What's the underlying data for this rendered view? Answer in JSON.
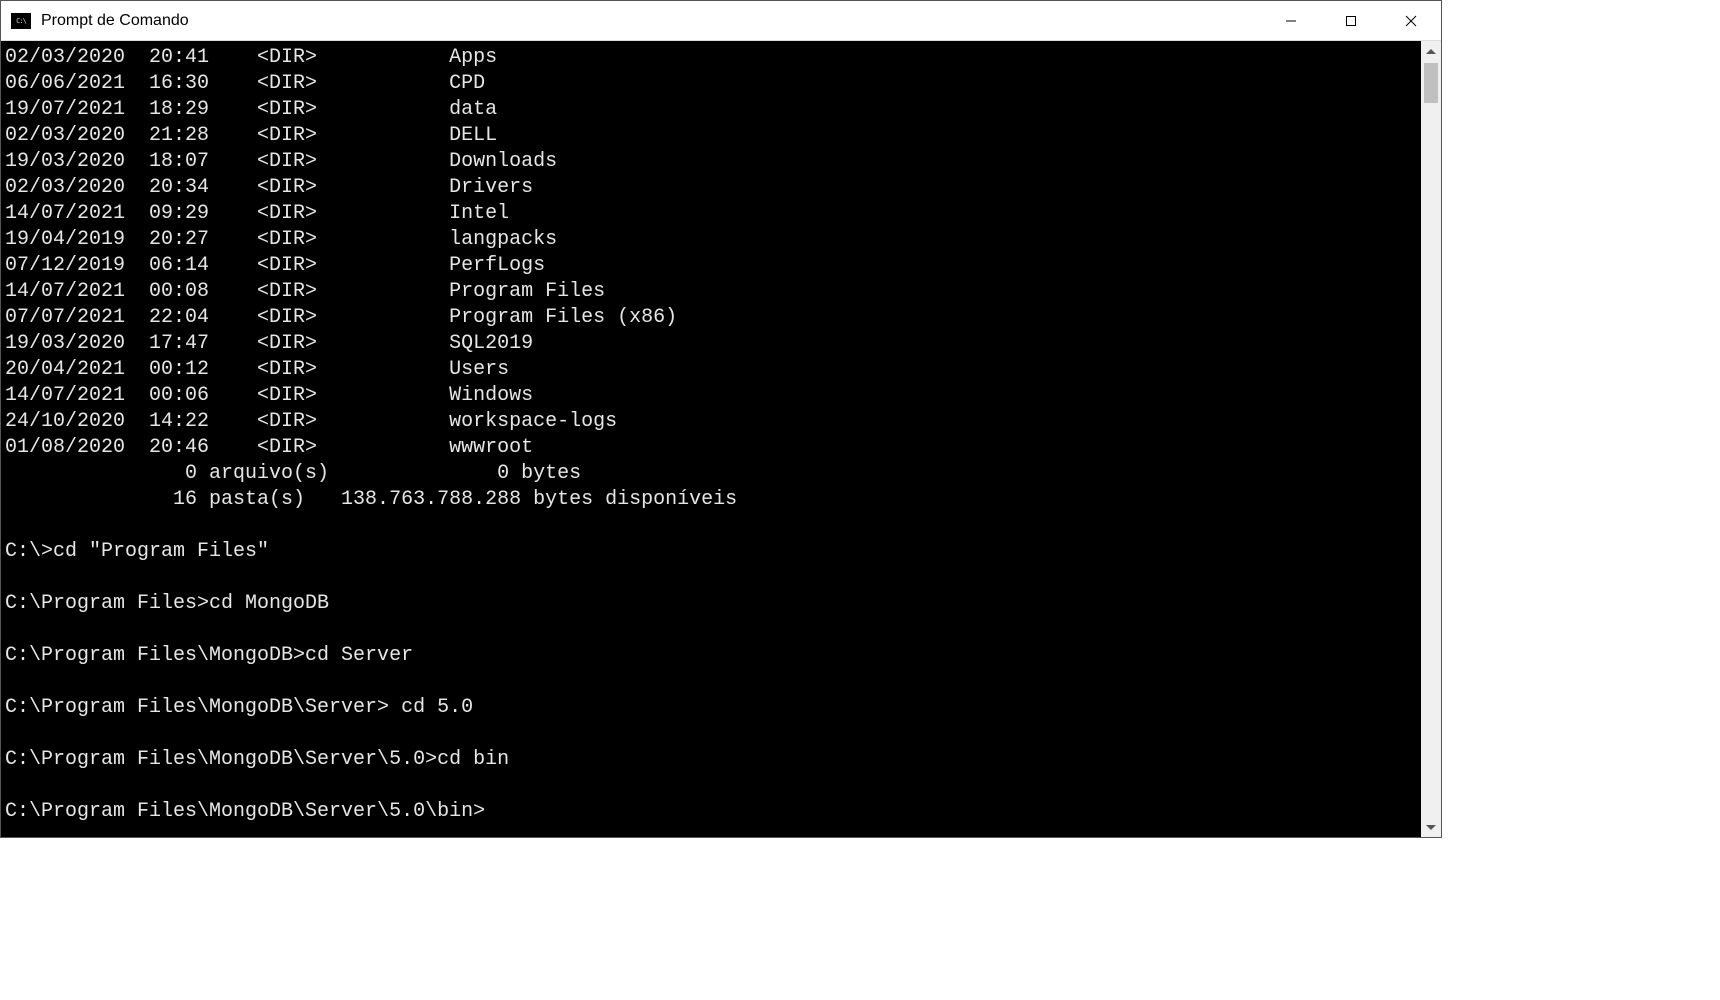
{
  "window": {
    "title": "Prompt de Comando"
  },
  "dir_entries": [
    {
      "date": "02/03/2020",
      "time": "20:41",
      "tag": "<DIR>",
      "size": "",
      "name": "Apps"
    },
    {
      "date": "06/06/2021",
      "time": "16:30",
      "tag": "<DIR>",
      "size": "",
      "name": "CPD"
    },
    {
      "date": "19/07/2021",
      "time": "18:29",
      "tag": "<DIR>",
      "size": "",
      "name": "data"
    },
    {
      "date": "02/03/2020",
      "time": "21:28",
      "tag": "<DIR>",
      "size": "",
      "name": "DELL"
    },
    {
      "date": "19/03/2020",
      "time": "18:07",
      "tag": "<DIR>",
      "size": "",
      "name": "Downloads"
    },
    {
      "date": "02/03/2020",
      "time": "20:34",
      "tag": "<DIR>",
      "size": "",
      "name": "Drivers"
    },
    {
      "date": "14/07/2021",
      "time": "09:29",
      "tag": "<DIR>",
      "size": "",
      "name": "Intel"
    },
    {
      "date": "19/04/2019",
      "time": "20:27",
      "tag": "<DIR>",
      "size": "",
      "name": "langpacks"
    },
    {
      "date": "07/12/2019",
      "time": "06:14",
      "tag": "<DIR>",
      "size": "",
      "name": "PerfLogs"
    },
    {
      "date": "14/07/2021",
      "time": "00:08",
      "tag": "<DIR>",
      "size": "",
      "name": "Program Files"
    },
    {
      "date": "07/07/2021",
      "time": "22:04",
      "tag": "<DIR>",
      "size": "",
      "name": "Program Files (x86)"
    },
    {
      "date": "19/03/2020",
      "time": "17:47",
      "tag": "<DIR>",
      "size": "",
      "name": "SQL2019"
    },
    {
      "date": "20/04/2021",
      "time": "00:12",
      "tag": "<DIR>",
      "size": "",
      "name": "Users"
    },
    {
      "date": "14/07/2021",
      "time": "00:06",
      "tag": "<DIR>",
      "size": "",
      "name": "Windows"
    },
    {
      "date": "24/10/2020",
      "time": "14:22",
      "tag": "<DIR>",
      "size": "",
      "name": "workspace-logs"
    },
    {
      "date": "01/08/2020",
      "time": "20:46",
      "tag": "<DIR>",
      "size": "",
      "name": "wwwroot"
    }
  ],
  "summary": {
    "files_line": "               0 arquivo(s)              0 bytes",
    "dirs_line": "              16 pasta(s)   138.763.788.288 bytes disponíveis"
  },
  "commands": [
    {
      "prompt": "C:\\>",
      "cmd": "cd \"Program Files\""
    },
    {
      "prompt": "C:\\Program Files>",
      "cmd": "cd MongoDB"
    },
    {
      "prompt": "C:\\Program Files\\MongoDB>",
      "cmd": "cd Server"
    },
    {
      "prompt": "C:\\Program Files\\MongoDB\\Server> ",
      "cmd": "cd 5.0"
    },
    {
      "prompt": "C:\\Program Files\\MongoDB\\Server\\5.0>",
      "cmd": "cd bin"
    },
    {
      "prompt": "C:\\Program Files\\MongoDB\\Server\\5.0\\bin>",
      "cmd": ""
    }
  ]
}
